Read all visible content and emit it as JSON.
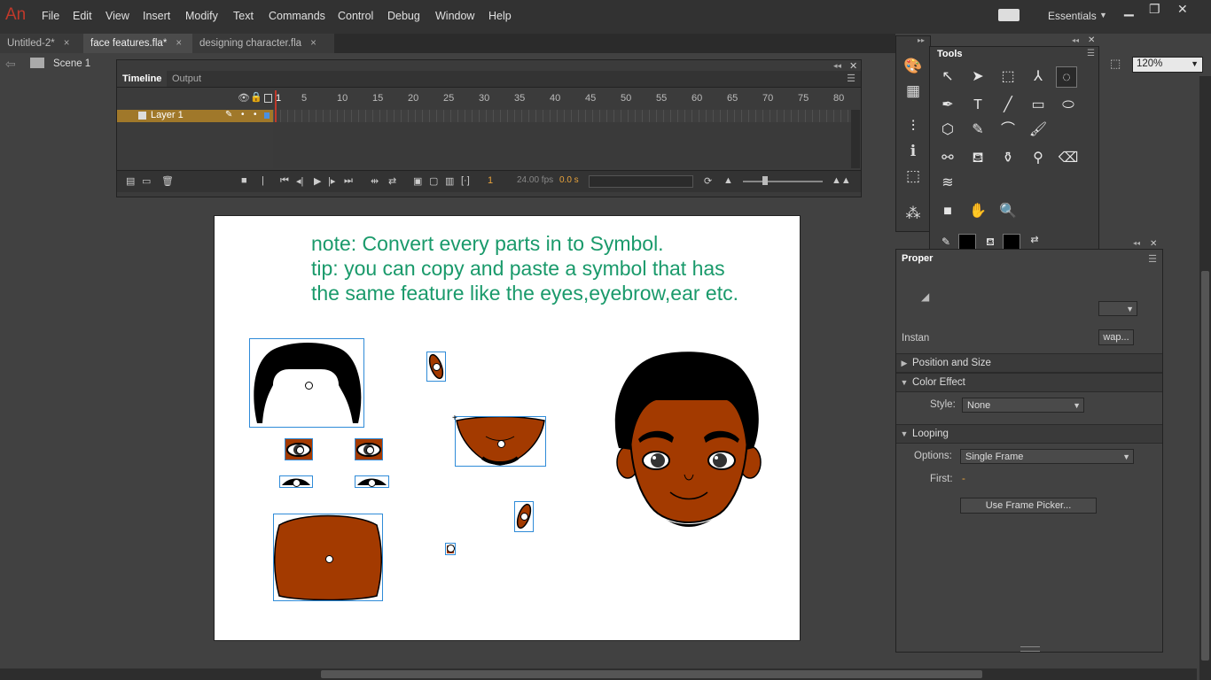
{
  "app": {
    "logo": "An"
  },
  "menu": [
    "File",
    "Edit",
    "View",
    "Insert",
    "Modify",
    "Text",
    "Commands",
    "Control",
    "Debug",
    "Window",
    "Help"
  ],
  "workspace": "Essentials",
  "window_controls": {
    "minimize": "▁",
    "restore": "❐",
    "close": "✕"
  },
  "doc_tabs": [
    {
      "label": "Untitled-2*",
      "close": "×"
    },
    {
      "label": "face features.fla*",
      "close": "×"
    },
    {
      "label": "designing character.fla",
      "close": "×"
    }
  ],
  "editbar": {
    "back": "⇦",
    "scene": "Scene 1",
    "zoom": "120%"
  },
  "timeline": {
    "tabs": [
      "Timeline",
      "Output"
    ],
    "ruler": [
      "1",
      "5",
      "10",
      "15",
      "20",
      "25",
      "30",
      "35",
      "40",
      "45",
      "50",
      "55",
      "60",
      "65",
      "70",
      "75",
      "80"
    ],
    "layer": "Layer 1",
    "frame": "1",
    "fps": "24.00 fps",
    "time": "0.0 s"
  },
  "stage": {
    "note_lines": [
      "note: Convert every parts in to Symbol.",
      "tip: you can copy and paste a symbol that has",
      "the same feature like the eyes,eyebrow,ear etc."
    ]
  },
  "tools": {
    "title": "Tools"
  },
  "properties": {
    "title": "Proper",
    "instance_label": "Instan",
    "swap_label": "wap...",
    "sections": {
      "position": "Position and Size",
      "color": "Color Effect",
      "looping": "Looping"
    },
    "style_label": "Style:",
    "style_value": "None",
    "options_label": "Options:",
    "options_value": "Single Frame",
    "first_label": "First:",
    "first_value": "-",
    "frame_picker": "Use Frame Picker..."
  },
  "colors": {
    "skin": "#a33a00",
    "hair": "#000000",
    "note": "#1a9a6b",
    "selection": "#2f8bd8"
  }
}
